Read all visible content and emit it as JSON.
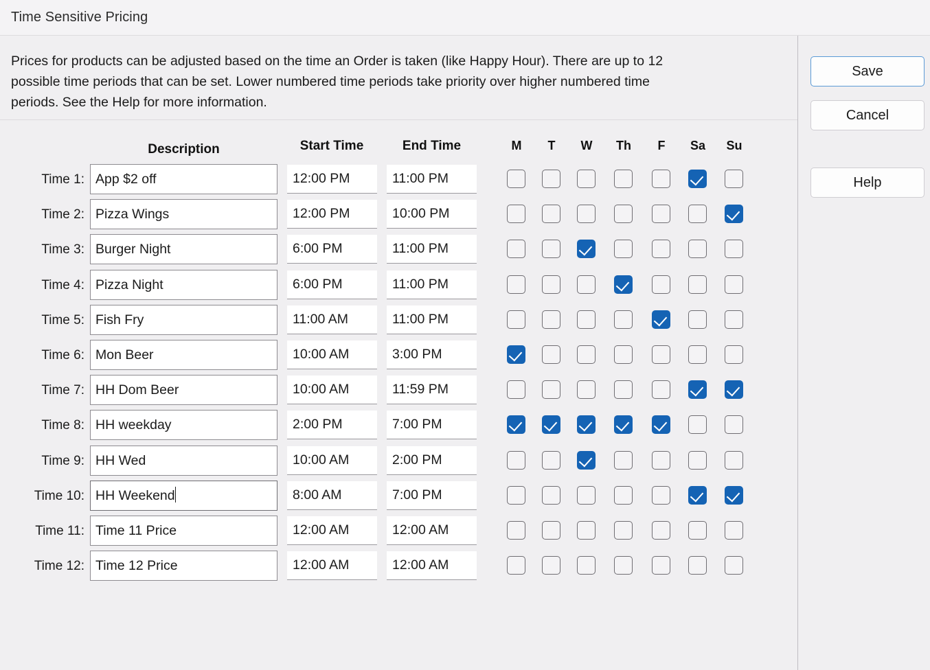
{
  "window": {
    "title": "Time Sensitive Pricing"
  },
  "intro": {
    "text": "Prices for products can be adjusted based on the time an Order is taken (like Happy Hour). There are up to 12\npossible time periods that can be set. Lower numbered time periods take priority over higher numbered time\nperiods.  See the Help for more information."
  },
  "colors": {
    "checkbox_checked": "#1563b4",
    "focus_border": "#5a9ad6",
    "pane_background": "#f0eff1",
    "field_background": "#ffffff"
  },
  "headers": {
    "description": "Description",
    "start_time": "Start Time",
    "end_time": "End Time",
    "days": [
      "M",
      "T",
      "W",
      "Th",
      "F",
      "Sa",
      "Su"
    ]
  },
  "buttons": {
    "save": "Save",
    "cancel": "Cancel",
    "help": "Help"
  },
  "rows": [
    {
      "label": "Time 1:",
      "description": "App $2 off",
      "start": "12:00 PM",
      "end": "11:00 PM",
      "days": [
        false,
        false,
        false,
        false,
        false,
        true,
        false
      ],
      "focused": false
    },
    {
      "label": "Time 2:",
      "description": "Pizza Wings",
      "start": "12:00 PM",
      "end": "10:00 PM",
      "days": [
        false,
        false,
        false,
        false,
        false,
        false,
        true
      ],
      "focused": false
    },
    {
      "label": "Time 3:",
      "description": "Burger Night",
      "start": "6:00 PM",
      "end": "11:00 PM",
      "days": [
        false,
        false,
        true,
        false,
        false,
        false,
        false
      ],
      "focused": false
    },
    {
      "label": "Time 4:",
      "description": "Pizza Night",
      "start": "6:00 PM",
      "end": "11:00 PM",
      "days": [
        false,
        false,
        false,
        true,
        false,
        false,
        false
      ],
      "focused": false
    },
    {
      "label": "Time 5:",
      "description": "Fish Fry",
      "start": "11:00 AM",
      "end": "11:00 PM",
      "days": [
        false,
        false,
        false,
        false,
        true,
        false,
        false
      ],
      "focused": false
    },
    {
      "label": "Time 6:",
      "description": "Mon Beer",
      "start": "10:00 AM",
      "end": "3:00 PM",
      "days": [
        true,
        false,
        false,
        false,
        false,
        false,
        false
      ],
      "focused": false
    },
    {
      "label": "Time 7:",
      "description": "HH Dom Beer",
      "start": "10:00 AM",
      "end": "11:59 PM",
      "days": [
        false,
        false,
        false,
        false,
        false,
        true,
        true
      ],
      "focused": false
    },
    {
      "label": "Time 8:",
      "description": "HH weekday",
      "start": "2:00 PM",
      "end": "7:00 PM",
      "days": [
        true,
        true,
        true,
        true,
        true,
        false,
        false
      ],
      "focused": false
    },
    {
      "label": "Time 9:",
      "description": "HH Wed",
      "start": "10:00 AM",
      "end": "2:00 PM",
      "days": [
        false,
        false,
        true,
        false,
        false,
        false,
        false
      ],
      "focused": false
    },
    {
      "label": "Time 10:",
      "description": "HH Weekend",
      "start": "8:00 AM",
      "end": "7:00 PM",
      "days": [
        false,
        false,
        false,
        false,
        false,
        true,
        true
      ],
      "focused": true
    },
    {
      "label": "Time 11:",
      "description": "Time 11 Price",
      "start": "12:00 AM",
      "end": "12:00 AM",
      "days": [
        false,
        false,
        false,
        false,
        false,
        false,
        false
      ],
      "focused": false
    },
    {
      "label": "Time 12:",
      "description": "Time 12 Price",
      "start": "12:00 AM",
      "end": "12:00 AM",
      "days": [
        false,
        false,
        false,
        false,
        false,
        false,
        false
      ],
      "focused": false
    }
  ]
}
